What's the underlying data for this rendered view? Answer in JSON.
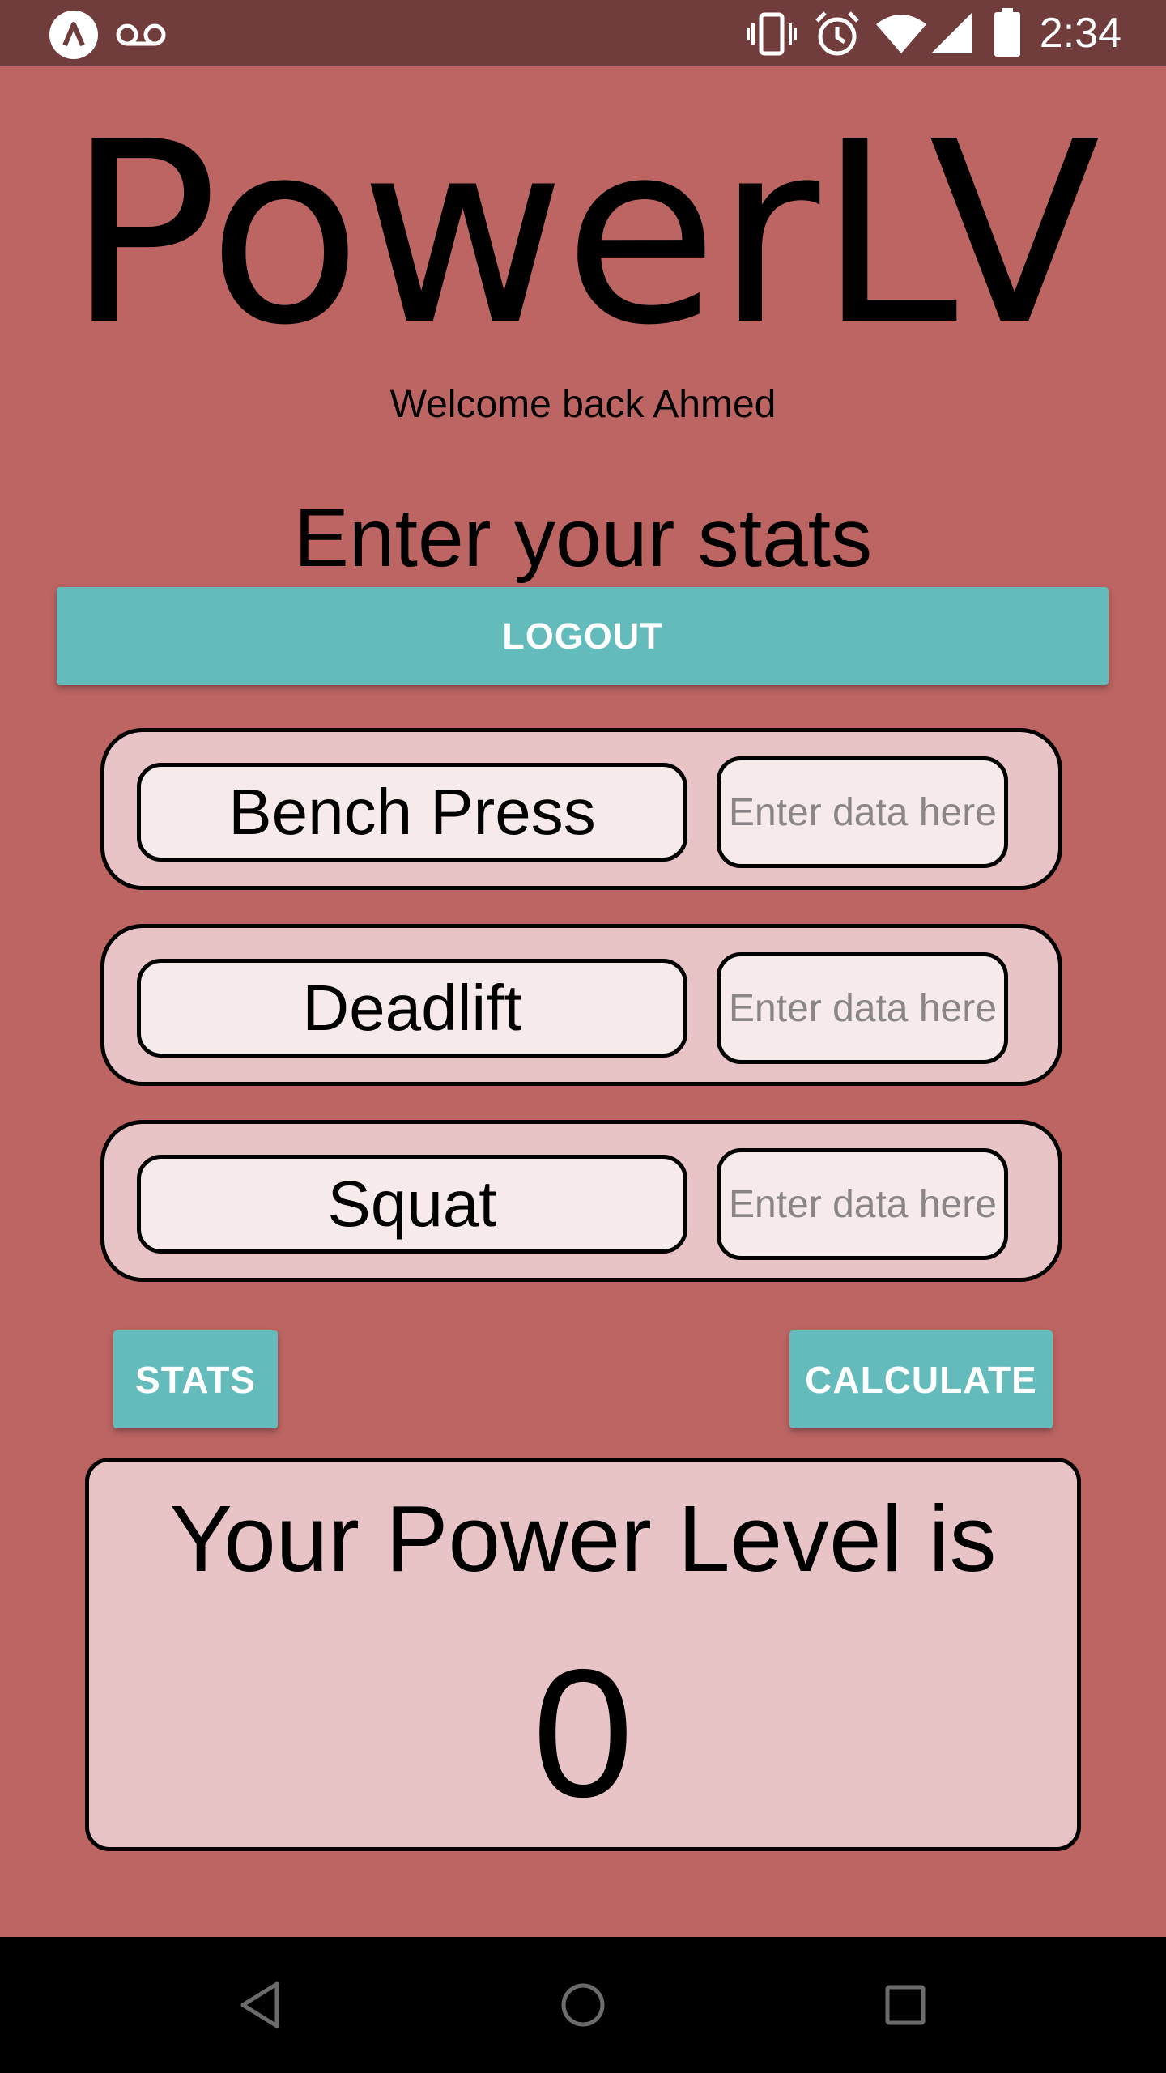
{
  "status_bar": {
    "time": "2:34",
    "left_icons": [
      "app-notification-icon",
      "voicemail-icon"
    ],
    "right_icons": [
      "vibrate-icon",
      "alarm-icon",
      "wifi-icon",
      "cell-signal-icon",
      "battery-icon"
    ]
  },
  "app": {
    "title": "PowerLV",
    "welcome": "Welcome back Ahmed",
    "subtitle": "Enter your stats",
    "logout_label": "LOGOUT"
  },
  "stats": [
    {
      "label": "Bench Press",
      "placeholder": "Enter data here",
      "value": ""
    },
    {
      "label": "Deadlift",
      "placeholder": "Enter data here",
      "value": ""
    },
    {
      "label": "Squat",
      "placeholder": "Enter data here",
      "value": ""
    }
  ],
  "actions": {
    "stats_label": "STATS",
    "calculate_label": "CALCULATE"
  },
  "result": {
    "label": "Your Power Level is",
    "value": "0"
  },
  "nav_bar": {
    "buttons": [
      "back-icon",
      "home-icon",
      "recents-icon"
    ]
  },
  "colors": {
    "background": "#bc6563",
    "status_bar": "#713c3c",
    "accent_button": "#63bcbb",
    "card": "#e8c4c6",
    "field": "#f6eaea"
  }
}
